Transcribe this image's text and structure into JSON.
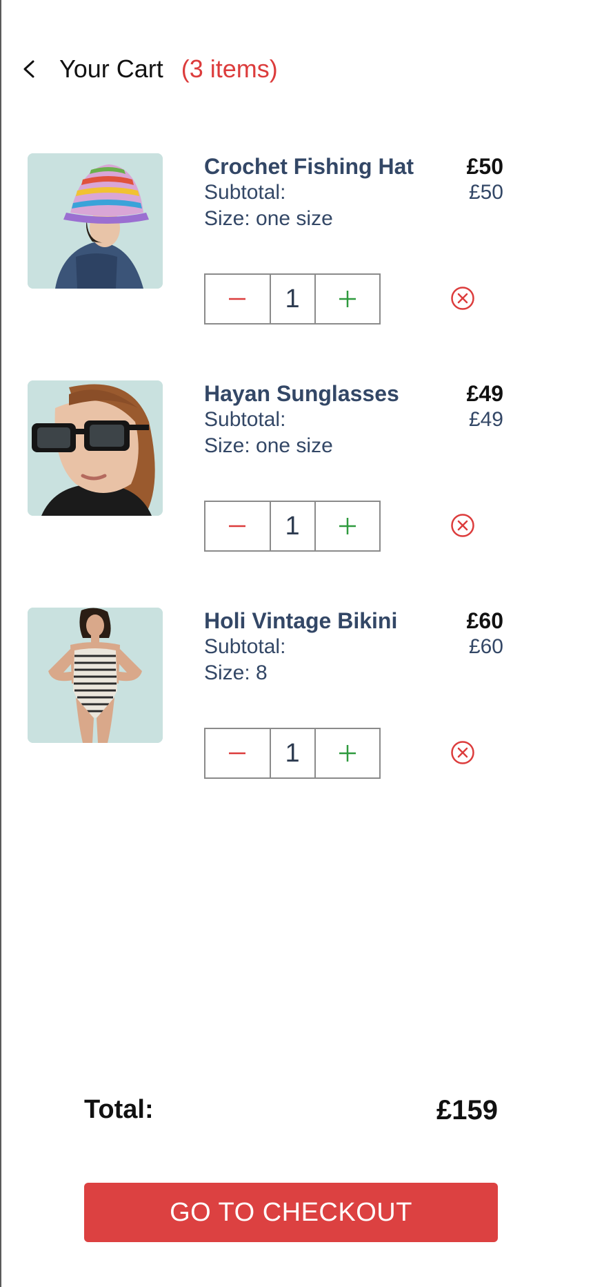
{
  "header": {
    "back_icon": "chevron-left-icon",
    "title": "Your Cart",
    "count": "(3 items)"
  },
  "cart": {
    "items": [
      {
        "name": "Crochet Fishing Hat",
        "price": "£50",
        "subtotal_label": "Subtotal:",
        "subtotal_value": "£50",
        "size": "Size: one size",
        "quantity": "1",
        "image_icon": "crochet-hat-product-image"
      },
      {
        "name": "Hayan Sunglasses",
        "price": "£49",
        "subtotal_label": "Subtotal:",
        "subtotal_value": "£49",
        "size": "Size: one size",
        "quantity": "1",
        "image_icon": "sunglasses-product-image"
      },
      {
        "name": "Holi Vintage Bikini",
        "price": "£60",
        "subtotal_label": "Subtotal:",
        "subtotal_value": "£60",
        "size": "Size: 8",
        "quantity": "1",
        "image_icon": "bikini-product-image"
      }
    ]
  },
  "summary": {
    "total_label": "Total:",
    "total_value": "£159",
    "checkout_label": "GO TO CHECKOUT"
  },
  "colors": {
    "accent": "#dc3c3c",
    "minus": "#dc3c3c",
    "plus": "#2e9a3e",
    "text": "#334766",
    "image_bg": "#c9e1df"
  }
}
